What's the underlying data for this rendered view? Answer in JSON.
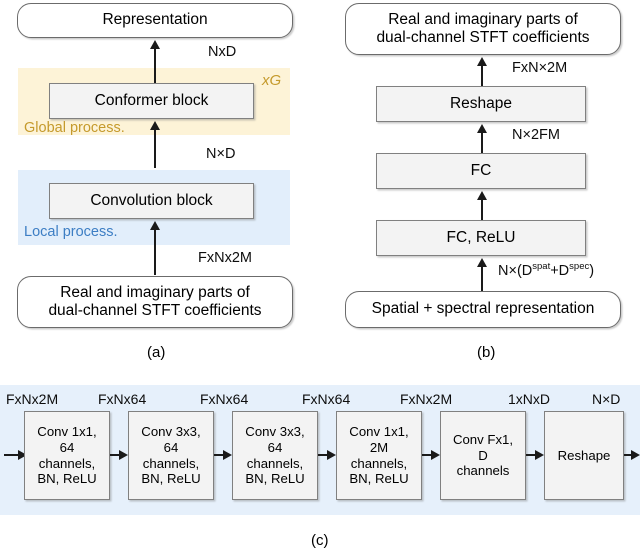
{
  "figure": {
    "panels": [
      {
        "id": "a",
        "caption": "(a)",
        "top_box": "Representation",
        "bottom_box_line1": "Real and imaginary parts of",
        "bottom_box_line2": "dual-channel STFT coefficients",
        "blocks": [
          {
            "label": "Conformer block"
          },
          {
            "label": "Convolution block"
          }
        ],
        "bands": [
          {
            "name": "Global process.",
            "repeat": "xG",
            "color": "#fdf3d7",
            "text_color": "#c59a2c"
          },
          {
            "name": "Local process.",
            "color": "#e2eefb",
            "text_color": "#3d7ec4"
          }
        ],
        "dims": [
          {
            "text": "NxD"
          },
          {
            "text": "N×D"
          },
          {
            "text": "FxNx2M"
          }
        ]
      },
      {
        "id": "b",
        "caption": "(b)",
        "top_box_line1": "Real and imaginary parts of",
        "top_box_line2": "dual-channel STFT coefficients",
        "bottom_box": "Spatial + spectral representation",
        "blocks": [
          {
            "label": "Reshape"
          },
          {
            "label": "FC"
          },
          {
            "label": "FC, ReLU"
          }
        ],
        "dims": [
          {
            "text": "FxN×2M"
          },
          {
            "text": "N×2FM"
          },
          {
            "text": "N×(D",
            "sup1": "spat",
            "mid": "+D",
            "sup2": "spec",
            "tail": ")"
          }
        ]
      },
      {
        "id": "c",
        "caption": "(c)",
        "band_color": "#e6f0fb",
        "blocks": [
          {
            "lines": [
              "Conv 1x1,",
              "64",
              "channels,",
              "BN, ReLU"
            ]
          },
          {
            "lines": [
              "Conv 3x3,",
              "64",
              "channels,",
              "BN, ReLU"
            ]
          },
          {
            "lines": [
              "Conv 3x3,",
              "64",
              "channels,",
              "BN, ReLU"
            ]
          },
          {
            "lines": [
              "Conv 1x1,",
              "2M",
              "channels,",
              "BN, ReLU"
            ]
          },
          {
            "lines": [
              "Conv Fx1,",
              "D",
              "channels"
            ]
          },
          {
            "lines": [
              "Reshape"
            ]
          }
        ],
        "dims": [
          "FxNx2M",
          "FxNx64",
          "FxNx64",
          "FxNx64",
          "FxNx2M",
          "1xNxD",
          "N×D"
        ]
      }
    ]
  },
  "colors": {
    "global_band": "#fdf3d7",
    "local_band": "#e2eefb",
    "conv_band": "#e6f0fb",
    "global_text": "#c59a2c",
    "local_text": "#3d7ec4",
    "box_fill": "#f3f3f3",
    "box_border": "#808080",
    "arrow": "#1a1a1a"
  }
}
